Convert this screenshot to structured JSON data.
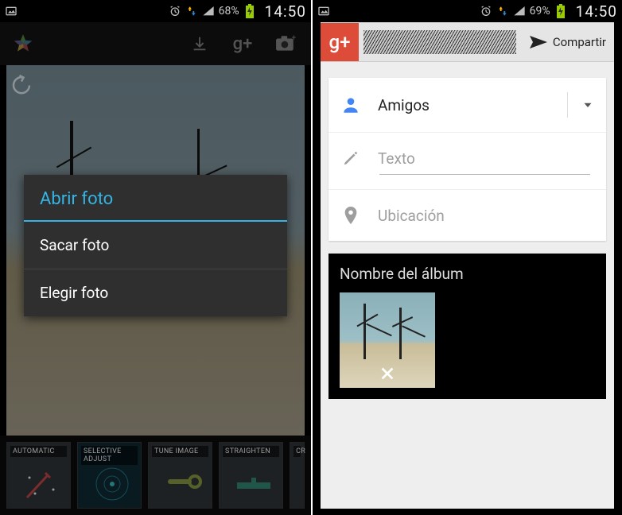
{
  "left": {
    "status": {
      "battery_pct": "68%",
      "time": "14:50"
    },
    "dialog": {
      "title": "Abrir foto",
      "items": [
        "Sacar foto",
        "Elegir foto"
      ]
    },
    "filters": [
      "AUTOMATIC",
      "SELECTIVE ADJUST",
      "TUNE IMAGE",
      "STRAIGHTEN",
      "CR"
    ]
  },
  "right": {
    "status": {
      "battery_pct": "69%",
      "time": "14:50"
    },
    "share_label": "Compartir",
    "audience": "Amigos",
    "text_placeholder": "Texto",
    "location_placeholder": "Ubicación",
    "album_name": "Nombre del álbum"
  }
}
